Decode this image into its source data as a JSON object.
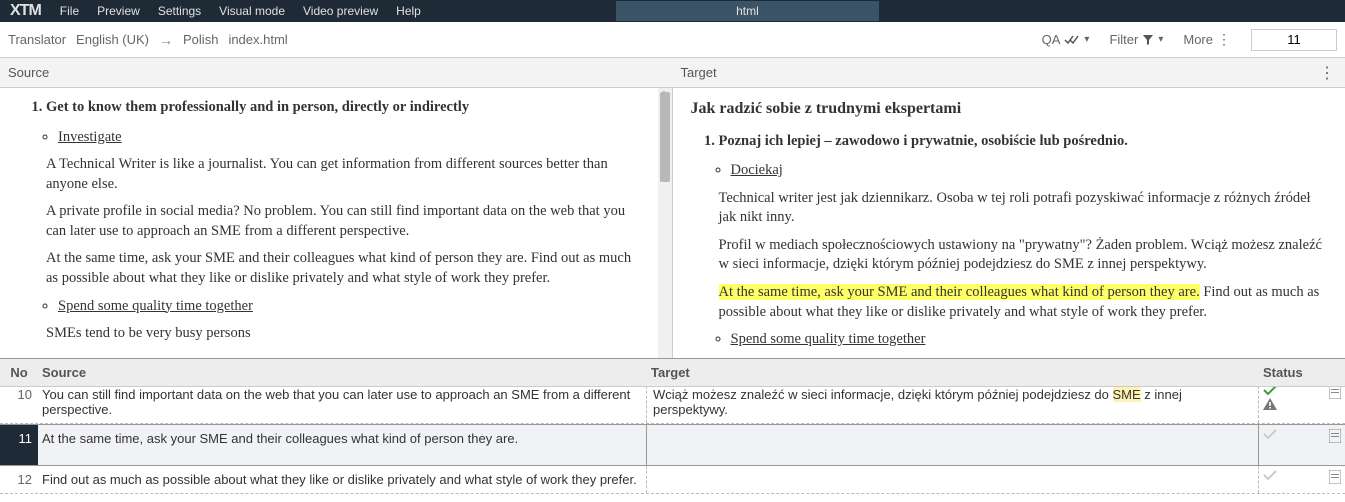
{
  "topbar": {
    "logo": "XTM",
    "menu": [
      "File",
      "Preview",
      "Settings",
      "Visual mode",
      "Video preview",
      "Help"
    ],
    "tab": "html"
  },
  "subhead": {
    "role": "Translator",
    "src_lang": "English (UK)",
    "tgt_lang": "Polish",
    "file": "index.html",
    "qa": "QA",
    "filter": "Filter",
    "more": "More",
    "segment_no": "11"
  },
  "colhead": {
    "source": "Source",
    "target": "Target"
  },
  "preview": {
    "src": {
      "li1": "Get to know them professionally and in person, directly or indirectly",
      "sub1": "Investigate",
      "p1": "A Technical Writer is like a journalist. You can get information from different sources better than anyone else.",
      "p2": "A private profile in social media? No problem. You can still find important data on the web that you can later use to approach an SME from a different perspective.",
      "p3a": "At the same time, ask your SME and their colleagues what kind of person they are. Find out as much as possible about what they like or dislike privately and what style of work they prefer.",
      "sub2": "Spend some quality time together",
      "p4": "SMEs tend to be very busy persons"
    },
    "tgt": {
      "h3": "Jak radzić sobie z trudnymi ekspertami",
      "li1": "Poznaj ich lepiej – zawodowo i prywatnie, osobiście lub pośrednio.",
      "sub1": "Dociekaj",
      "p1": "Technical writer jest jak dziennikarz. Osoba w tej roli potrafi pozyskiwać informacje z różnych źródeł jak nikt inny.",
      "p2": "Profil w mediach społecznościowych ustawiony na \"prywatny\"?  Żaden problem. Wciąż możesz znaleźć w sieci informacje, dzięki którym później podejdziesz do SME z innej perspektywy.",
      "p3_hl": "At the same time, ask your SME and their colleagues what kind of person they are.",
      "p3_rest": " Find out as much as possible about what they like or dislike privately and what style of work they prefer.",
      "sub2": "Spend some quality time together"
    }
  },
  "gridhead": {
    "no": "No",
    "source": "Source",
    "target": "Target",
    "status": "Status"
  },
  "rows": [
    {
      "no": "10",
      "src": "You can still find important data on the web that you can later use to approach an SME from a different perspective.",
      "tgt_pre": "Wciąż możesz znaleźć w sieci informacje, dzięki którym później podejdziesz do ",
      "tgt_term": "SME",
      "tgt_post": " z innej perspektywy.",
      "status": "done"
    },
    {
      "no": "11",
      "src": "At the same time, ask your SME and their colleagues what kind of person they are.",
      "tgt": "",
      "status": "pending"
    },
    {
      "no": "12",
      "src": "Find out as much as possible about what they like or dislike privately and what style of work they prefer.",
      "tgt": "",
      "status": "pending"
    }
  ]
}
